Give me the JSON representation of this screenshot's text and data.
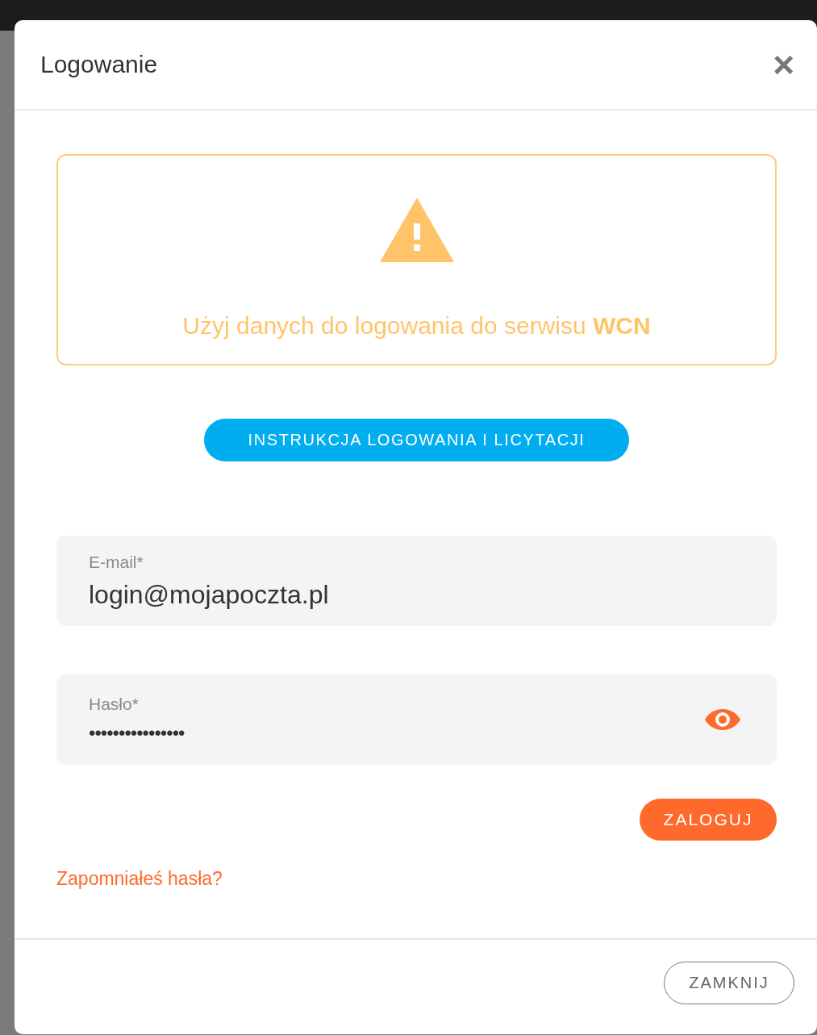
{
  "dialog": {
    "title": "Logowanie",
    "close_label": "×"
  },
  "alert": {
    "text": "Użyj danych do logowania do serwisu **WCN**"
  },
  "instructions_button": "INSTRUKCJA LOGOWANIA I LICYTACJI",
  "fields": [
    {
      "kind": "text",
      "label": "E-mail*",
      "value": "login@mojapoczta.pl"
    },
    {
      "kind": "password",
      "label": "Hasło*",
      "value": "••••••••••••••••"
    }
  ],
  "login_button": "ZALOGUJ",
  "forgot_link": "Zapomniałeś hasła?",
  "footer_button": "ZAMKNIJ"
}
